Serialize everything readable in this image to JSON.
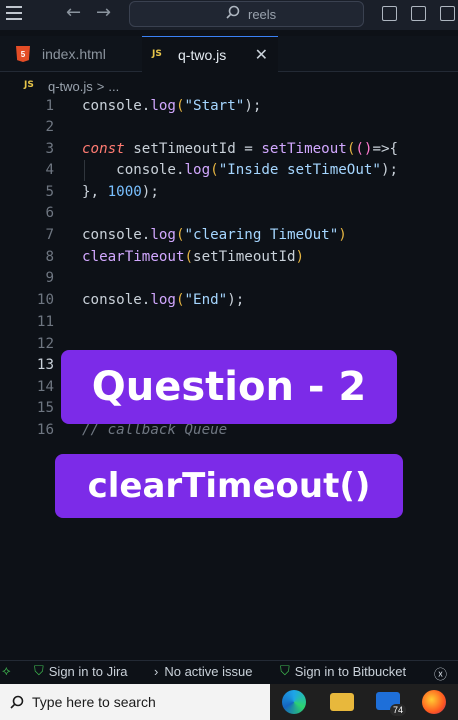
{
  "titlebar": {
    "search_text": "reels"
  },
  "tabs": [
    {
      "label": "index.html",
      "icon": "html5-icon"
    },
    {
      "label": "q-two.js",
      "icon": "js-icon",
      "close": "✕"
    }
  ],
  "breadcrumb": {
    "file": "q-two.js",
    "sep": ">",
    "more": "..."
  },
  "editor": {
    "line_numbers": [
      "1",
      "2",
      "3",
      "4",
      "5",
      "6",
      "7",
      "8",
      "9",
      "10",
      "11",
      "12",
      "13",
      "14",
      "15",
      "16"
    ],
    "lines": {
      "l1": {
        "a": "console",
        "b": ".",
        "c": "log",
        "d": "(",
        "e": "\"Start\"",
        "f": ");"
      },
      "l3": {
        "kw": "const",
        "v": " setTimeoutId = ",
        "fn": "setTimeout",
        "p1": "(",
        "p2": "()",
        "arrow": "=>{"
      },
      "l4": {
        "indent": "    ",
        "a": "console",
        "b": ".",
        "c": "log",
        "d": "(",
        "e": "\"Inside setTimeOut\"",
        "f": ");"
      },
      "l5": {
        "a": "}, ",
        "num": "1000",
        "f": ");"
      },
      "l7": {
        "a": "console",
        "b": ".",
        "c": "log",
        "d": "(",
        "e": "\"clearing TimeOut\"",
        "f": ")"
      },
      "l8": {
        "fn": "clearTimeout",
        "p": "(",
        "v": "setTimeoutId",
        "q": ")"
      },
      "l10": {
        "a": "console",
        "b": ".",
        "c": "log",
        "d": "(",
        "e": "\"End\"",
        "f": ");"
      },
      "l16": {
        "comment": "// callback Queue"
      }
    }
  },
  "overlays": {
    "question_label": "Question - 2",
    "question_title": "clearTimeout()"
  },
  "statusbar": {
    "jira": "Sign in to Jira",
    "issue": "No active issue",
    "bitbucket": "Sign in to Bitbucket"
  },
  "taskbar": {
    "search_placeholder": "Type here to search",
    "mail_badge": "74"
  },
  "colors": {
    "overlay": "#7c2be8",
    "editor_bg": "#0d1117",
    "accent": "#3b82f6"
  }
}
